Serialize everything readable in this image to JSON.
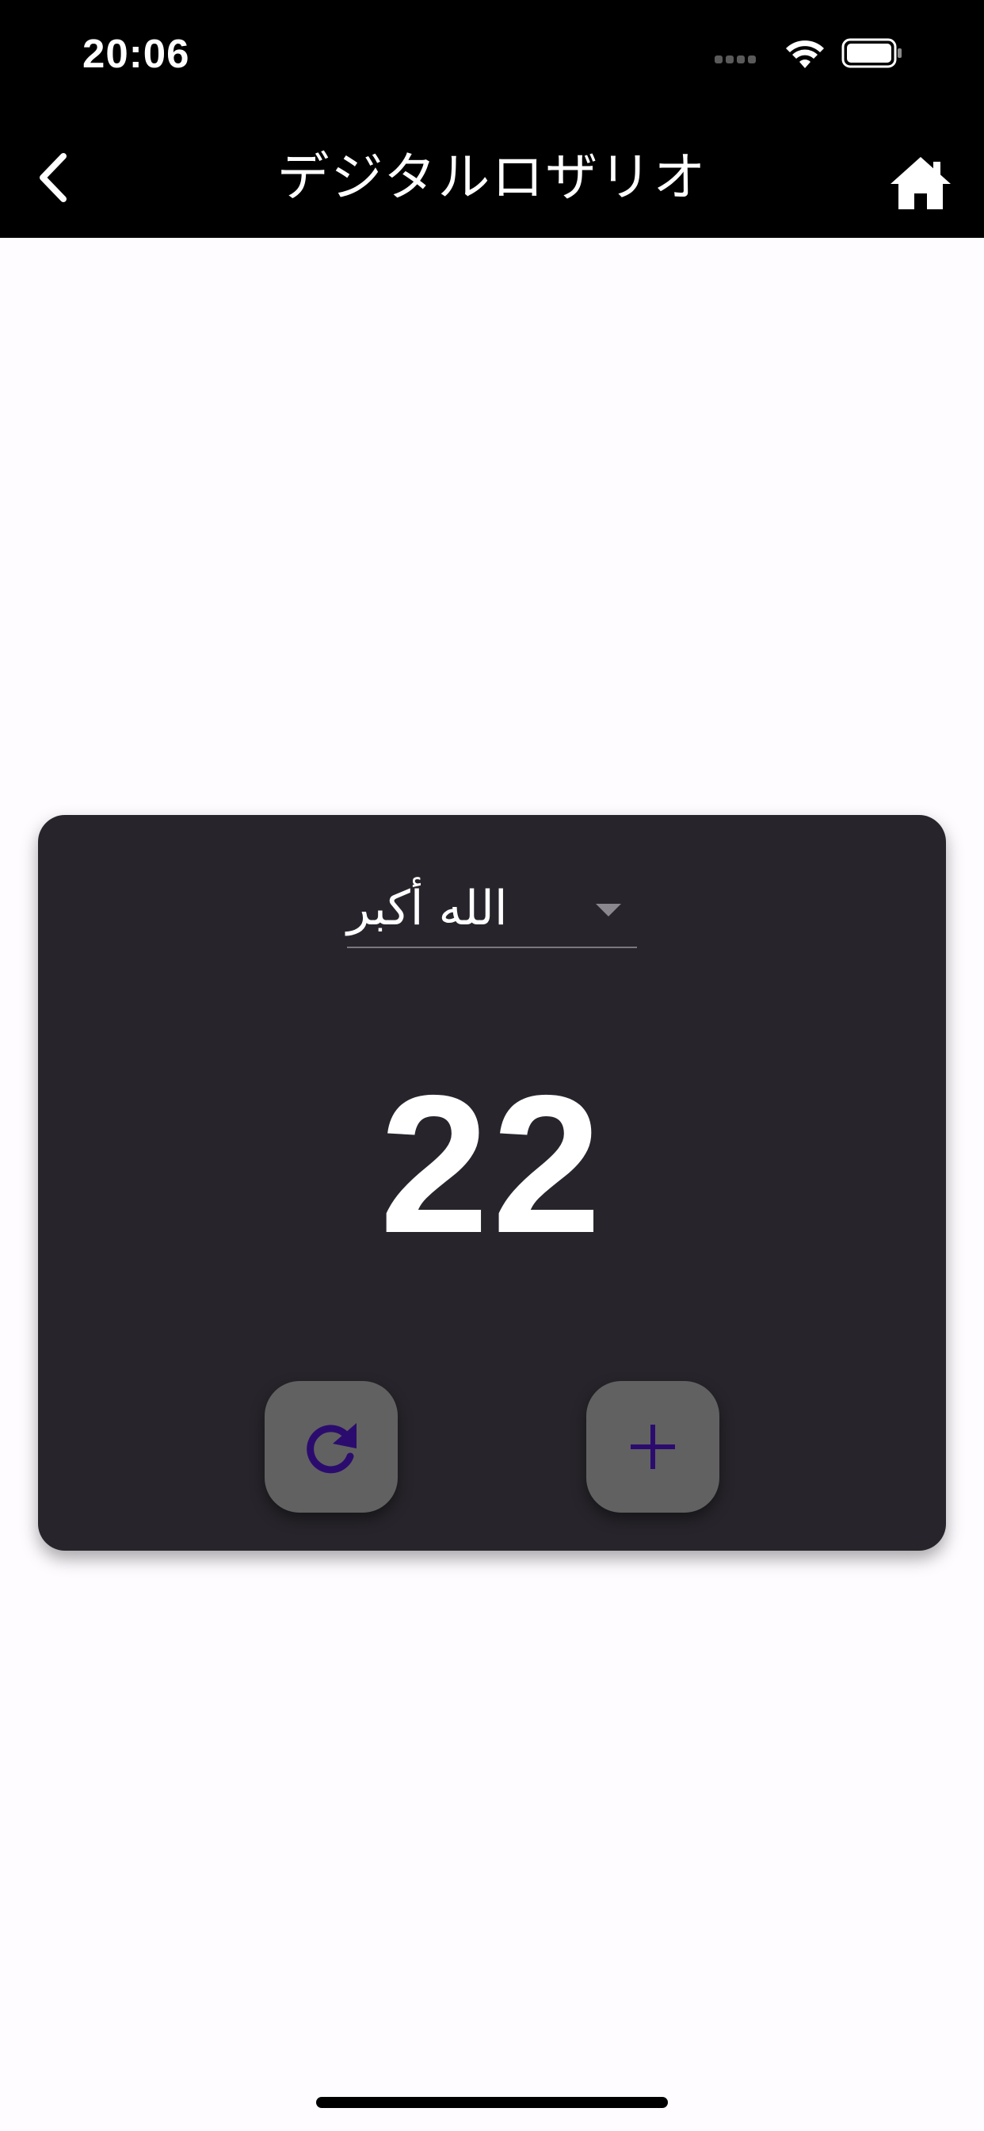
{
  "status_bar": {
    "time": "20:06",
    "icons": [
      "signal-icon",
      "wifi-icon",
      "battery-icon"
    ]
  },
  "nav": {
    "title": "デジタルロザリオ",
    "back_icon": "chevron-left-icon",
    "home_icon": "home-icon"
  },
  "counter_card": {
    "dropdown_selected": "الله أكبر",
    "count": "22",
    "reset_icon": "refresh-icon",
    "add_icon": "plus-icon"
  },
  "colors": {
    "bar_background": "#000000",
    "page_background": "#fefcff",
    "card_background": "#27252b",
    "button_background": "#616161",
    "icon_accent": "#2b0c6e"
  }
}
